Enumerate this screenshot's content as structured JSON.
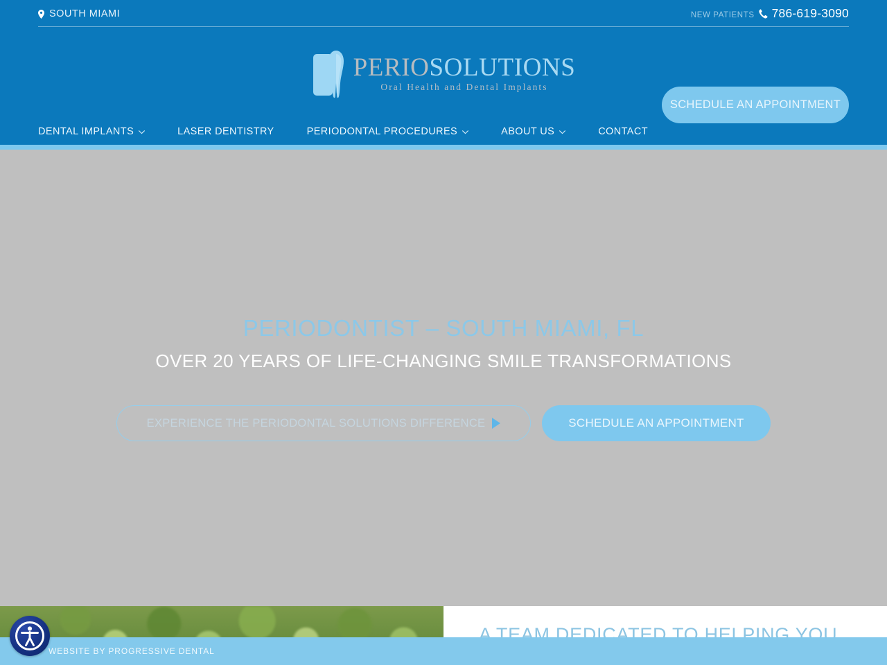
{
  "header": {
    "location_label": "SOUTH MIAMI",
    "location_icon": "map-pin-icon",
    "new_patients_label": "NEW PATIENTS",
    "phone_icon": "phone-icon",
    "phone_number": "786-619-3090",
    "logo": {
      "mark_icon": "tooth-logo-icon",
      "word_primary": "PERIO",
      "word_secondary": "SOLUTIONS",
      "tagline": "Oral Health and Dental Implants"
    },
    "nav": [
      {
        "label": "DENTAL IMPLANTS",
        "has_dropdown": true,
        "caret_icon": "chevron-down-icon"
      },
      {
        "label": "LASER DENTISTRY",
        "has_dropdown": false
      },
      {
        "label": "PERIODONTAL PROCEDURES",
        "has_dropdown": true,
        "caret_icon": "chevron-down-icon"
      },
      {
        "label": "ABOUT US",
        "has_dropdown": true,
        "caret_icon": "chevron-down-icon"
      },
      {
        "label": "CONTACT",
        "has_dropdown": false
      }
    ],
    "cta_label": "SCHEDULE AN APPOINTMENT",
    "background_color": "#0b79bc",
    "accent_color": "#7ec8ee"
  },
  "hero": {
    "title": "PERIODONTIST – SOUTH MIAMI, FL",
    "subtitle": "OVER 20 YEARS OF LIFE-CHANGING SMILE TRANSFORMATIONS",
    "video_button_label": "EXPERIENCE THE PERIODONTAL SOLUTIONS DIFFERENCE",
    "video_button_icon": "play-triangle-icon",
    "cta_label": "SCHEDULE AN APPOINTMENT",
    "background_color": "#bfbfbf",
    "title_color": "#8cc8e8"
  },
  "below_fold": {
    "photo_alt_name": "tropical-foliage-photo",
    "heading": "A TEAM DEDICATED TO HELPING YOU",
    "heading_color": "#8cc4e2"
  },
  "footer": {
    "credit": "WEBSITE BY PROGRESSIVE DENTAL",
    "background_color": "#83c9ec"
  },
  "accessibility_widget": {
    "icon": "accessibility-person-icon"
  }
}
